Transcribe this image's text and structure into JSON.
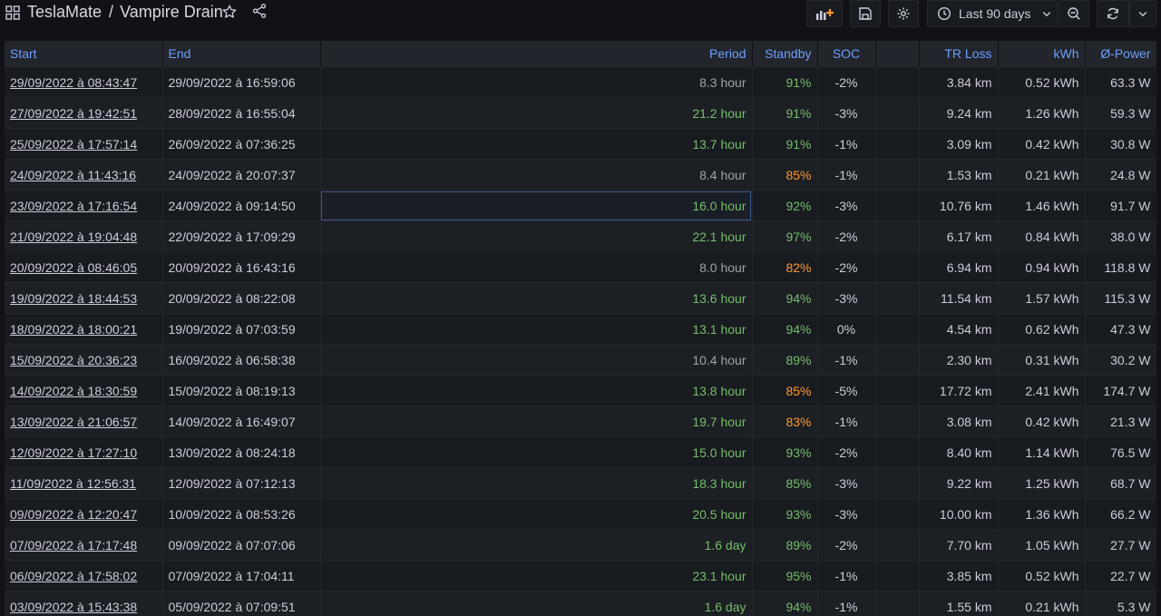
{
  "header": {
    "app_title": "TeslaMate",
    "separator": "/",
    "dashboard_title": "Vampire Drain",
    "time_range": "Last 90 days"
  },
  "table": {
    "columns": [
      "Start",
      "End",
      "Period",
      "Standby",
      "SOC",
      "TR Loss",
      "kWh",
      "Ø-Power"
    ],
    "rows": [
      {
        "start": "29/09/2022 à 08:43:47",
        "end": "29/09/2022 à 16:59:06",
        "period": "8.3 hour",
        "period_color": "gray",
        "standby": "91%",
        "standby_color": "green",
        "soc": "-2%",
        "tr_loss": "3.84 km",
        "kwh": "0.52 kWh",
        "power": "63.3 W"
      },
      {
        "start": "27/09/2022 à 19:42:51",
        "end": "28/09/2022 à 16:55:04",
        "period": "21.2 hour",
        "period_color": "green",
        "standby": "91%",
        "standby_color": "green",
        "soc": "-3%",
        "tr_loss": "9.24 km",
        "kwh": "1.26 kWh",
        "power": "59.3 W"
      },
      {
        "start": "25/09/2022 à 17:57:14",
        "end": "26/09/2022 à 07:36:25",
        "period": "13.7 hour",
        "period_color": "green",
        "standby": "91%",
        "standby_color": "green",
        "soc": "-1%",
        "tr_loss": "3.09 km",
        "kwh": "0.42 kWh",
        "power": "30.8 W"
      },
      {
        "start": "24/09/2022 à 11:43:16",
        "end": "24/09/2022 à 20:07:37",
        "period": "8.4 hour",
        "period_color": "gray",
        "standby": "85%",
        "standby_color": "orange",
        "soc": "-1%",
        "tr_loss": "1.53 km",
        "kwh": "0.21 kWh",
        "power": "24.8 W"
      },
      {
        "start": "23/09/2022 à 17:16:54",
        "end": "24/09/2022 à 09:14:50",
        "period": "16.0 hour",
        "period_color": "green",
        "standby": "92%",
        "standby_color": "green",
        "soc": "-3%",
        "tr_loss": "10.76 km",
        "kwh": "1.46 kWh",
        "power": "91.7 W"
      },
      {
        "start": "21/09/2022 à 19:04:48",
        "end": "22/09/2022 à 17:09:29",
        "period": "22.1 hour",
        "period_color": "green",
        "standby": "97%",
        "standby_color": "green",
        "soc": "-2%",
        "tr_loss": "6.17 km",
        "kwh": "0.84 kWh",
        "power": "38.0 W"
      },
      {
        "start": "20/09/2022 à 08:46:05",
        "end": "20/09/2022 à 16:43:16",
        "period": "8.0 hour",
        "period_color": "gray",
        "standby": "82%",
        "standby_color": "orange",
        "soc": "-2%",
        "tr_loss": "6.94 km",
        "kwh": "0.94 kWh",
        "power": "118.8 W"
      },
      {
        "start": "19/09/2022 à 18:44:53",
        "end": "20/09/2022 à 08:22:08",
        "period": "13.6 hour",
        "period_color": "green",
        "standby": "94%",
        "standby_color": "green",
        "soc": "-3%",
        "tr_loss": "11.54 km",
        "kwh": "1.57 kWh",
        "power": "115.3 W"
      },
      {
        "start": "18/09/2022 à 18:00:21",
        "end": "19/09/2022 à 07:03:59",
        "period": "13.1 hour",
        "period_color": "green",
        "standby": "94%",
        "standby_color": "green",
        "soc": "0%",
        "tr_loss": "4.54 km",
        "kwh": "0.62 kWh",
        "power": "47.3 W"
      },
      {
        "start": "15/09/2022 à 20:36:23",
        "end": "16/09/2022 à 06:58:38",
        "period": "10.4 hour",
        "period_color": "gray",
        "standby": "89%",
        "standby_color": "green",
        "soc": "-1%",
        "tr_loss": "2.30 km",
        "kwh": "0.31 kWh",
        "power": "30.2 W"
      },
      {
        "start": "14/09/2022 à 18:30:59",
        "end": "15/09/2022 à 08:19:13",
        "period": "13.8 hour",
        "period_color": "green",
        "standby": "85%",
        "standby_color": "orange",
        "soc": "-5%",
        "tr_loss": "17.72 km",
        "kwh": "2.41 kWh",
        "power": "174.7 W"
      },
      {
        "start": "13/09/2022 à 21:06:57",
        "end": "14/09/2022 à 16:49:07",
        "period": "19.7 hour",
        "period_color": "green",
        "standby": "83%",
        "standby_color": "orange",
        "soc": "-1%",
        "tr_loss": "3.08 km",
        "kwh": "0.42 kWh",
        "power": "21.3 W"
      },
      {
        "start": "12/09/2022 à 17:27:10",
        "end": "13/09/2022 à 08:24:18",
        "period": "15.0 hour",
        "period_color": "green",
        "standby": "93%",
        "standby_color": "green",
        "soc": "-2%",
        "tr_loss": "8.40 km",
        "kwh": "1.14 kWh",
        "power": "76.5 W"
      },
      {
        "start": "11/09/2022 à 12:56:31",
        "end": "12/09/2022 à 07:12:13",
        "period": "18.3 hour",
        "period_color": "green",
        "standby": "85%",
        "standby_color": "green",
        "soc": "-3%",
        "tr_loss": "9.22 km",
        "kwh": "1.25 kWh",
        "power": "68.7 W"
      },
      {
        "start": "09/09/2022 à 12:20:47",
        "end": "10/09/2022 à 08:53:26",
        "period": "20.5 hour",
        "period_color": "green",
        "standby": "93%",
        "standby_color": "green",
        "soc": "-3%",
        "tr_loss": "10.00 km",
        "kwh": "1.36 kWh",
        "power": "66.2 W"
      },
      {
        "start": "07/09/2022 à 17:17:48",
        "end": "09/09/2022 à 07:07:06",
        "period": "1.6 day",
        "period_color": "green",
        "standby": "89%",
        "standby_color": "green",
        "soc": "-2%",
        "tr_loss": "7.70 km",
        "kwh": "1.05 kWh",
        "power": "27.7 W"
      },
      {
        "start": "06/09/2022 à 17:58:02",
        "end": "07/09/2022 à 17:04:11",
        "period": "23.1 hour",
        "period_color": "green",
        "standby": "95%",
        "standby_color": "green",
        "soc": "-1%",
        "tr_loss": "3.85 km",
        "kwh": "0.52 kWh",
        "power": "22.7 W"
      },
      {
        "start": "03/09/2022 à 15:43:38",
        "end": "05/09/2022 à 07:09:51",
        "period": "1.6 day",
        "period_color": "green",
        "standby": "94%",
        "standby_color": "green",
        "soc": "-1%",
        "tr_loss": "1.55 km",
        "kwh": "0.21 kWh",
        "power": "5.3 W"
      }
    ]
  },
  "icons": {
    "apps": "grid-icon",
    "star": "star-icon",
    "share": "share-icon",
    "add_panel": "add-panel-icon",
    "save": "save-icon",
    "settings": "gear-icon",
    "clock": "clock-icon",
    "zoom_out": "zoom-out-icon",
    "refresh": "refresh-icon"
  }
}
